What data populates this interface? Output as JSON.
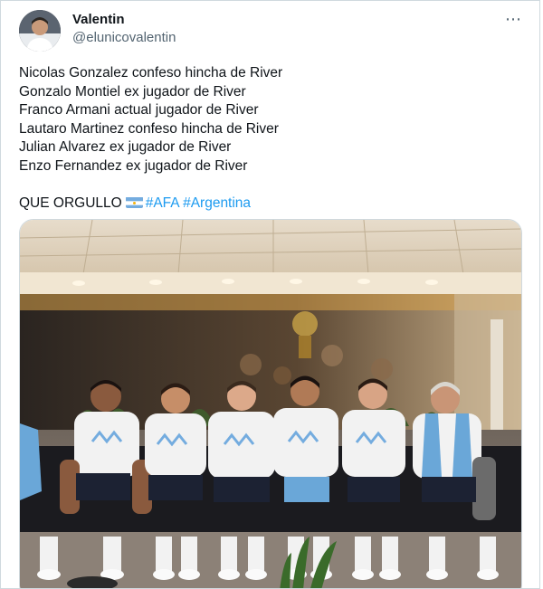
{
  "author": {
    "display_name": "Valentin",
    "handle": "@elunicovalentin",
    "avatar_icon": "user-avatar"
  },
  "more_icon": "⋯",
  "tweet": {
    "lines": [
      "Nicolas Gonzalez confeso hincha de River",
      "Gonzalo Montiel ex jugador de River",
      "Franco Armani actual jugador de River",
      "Lautaro Martinez confeso hincha de River",
      "Julian Alvarez ex jugador de River",
      "Enzo Fernandez ex jugador de River"
    ],
    "closing_text": "QUE ORGULLO",
    "flag_icon": "argentina-flag",
    "hashtags": [
      "#AFA",
      "#Argentina"
    ]
  },
  "colors": {
    "accent": "#1d9bf0",
    "text": "#0f1419",
    "secondary_text": "#536471",
    "border": "#cfd9de",
    "shirt": "#f2f2f2",
    "sky_blue": "#74acdf"
  },
  "media": {
    "kind": "photo",
    "subject_icon": "team-photo"
  }
}
